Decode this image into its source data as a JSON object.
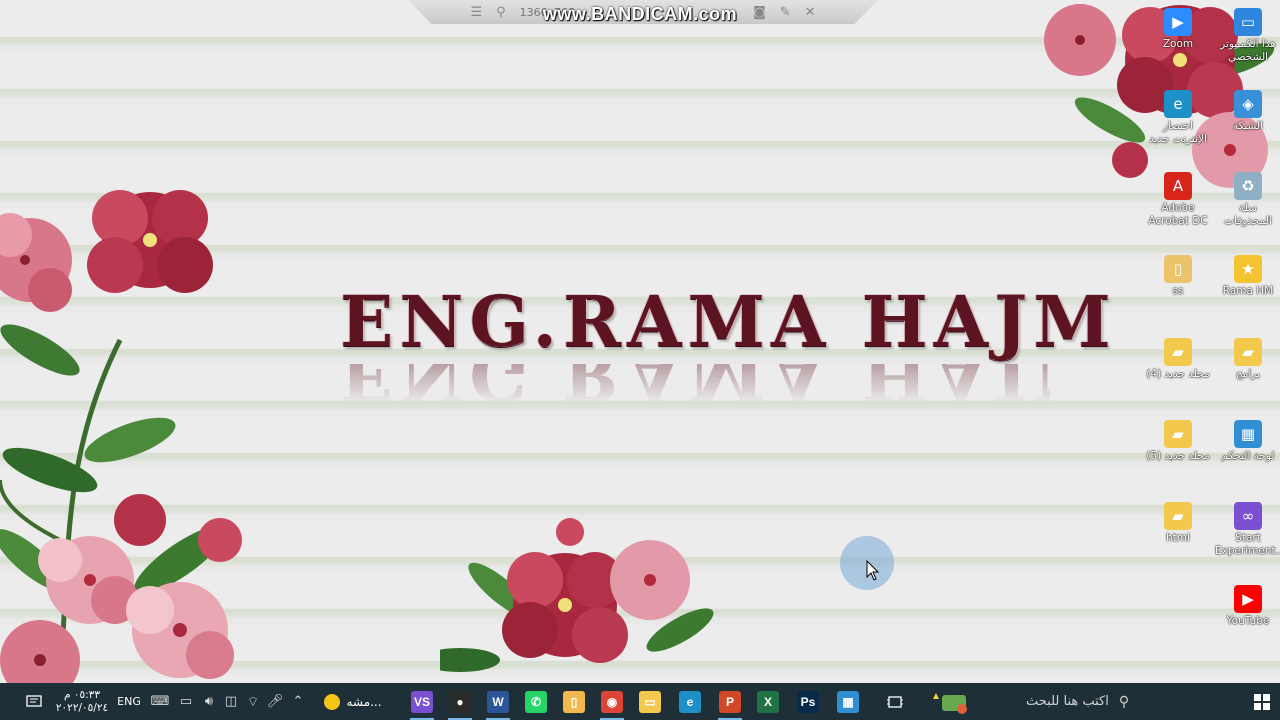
{
  "recorder": {
    "resolution_label": "1366x768",
    "watermark": "www.BANDICAM.com"
  },
  "wallpaper": {
    "title": "ENG.RAMA HAJM",
    "title_color": "#5c1420"
  },
  "desktop_icons": [
    {
      "label": "Zoom",
      "icon": "zoom-icon",
      "color": "#2d8cff"
    },
    {
      "label": "هذا الكمبيوتر الشخصي",
      "icon": "this-pc-icon",
      "color": "#2e86de"
    },
    {
      "label": "اختصار الإنترنت جديد",
      "icon": "edge-shortcut-icon",
      "color": "#1e90c8"
    },
    {
      "label": "الشبكة",
      "icon": "network-icon",
      "color": "#3a8fd9"
    },
    {
      "label": "Adobe Acrobat DC",
      "icon": "acrobat-icon",
      "color": "#d9241c"
    },
    {
      "label": "سلة المحذوفات",
      "icon": "recycle-bin-icon",
      "color": "#8fb0c4"
    },
    {
      "label": "ss",
      "icon": "file-icon",
      "color": "#e9c46a"
    },
    {
      "label": "Rama HM",
      "icon": "star-icon",
      "color": "#f4c430"
    },
    {
      "label": "مجلد جديد (4)",
      "icon": "folder-icon",
      "color": "#f2c94c"
    },
    {
      "label": "برامج",
      "icon": "folder-icon",
      "color": "#f2c94c"
    },
    {
      "label": "مجلد جديد (5)",
      "icon": "folder-icon",
      "color": "#f2c94c"
    },
    {
      "label": "لوحة التحكم",
      "icon": "control-panel-icon",
      "color": "#2f8fd2"
    },
    {
      "label": "html",
      "icon": "folder-icon",
      "color": "#f2c94c"
    },
    {
      "label": "Start Experiment...",
      "icon": "visual-studio-icon",
      "color": "#7b4fd1"
    },
    {
      "label": "YouTube",
      "icon": "youtube-icon",
      "color": "#ff0000"
    }
  ],
  "taskbar": {
    "clock_time": "٠٥:٣٣ م",
    "clock_date": "٢٠٢٢/٠٥/٢٤",
    "language": "ENG",
    "pinned_label": "مشه...",
    "search_placeholder": "اكتب هنا للبحث",
    "apps": [
      {
        "name": "visual-studio",
        "letter": "VS",
        "color": "#7b4fd1"
      },
      {
        "name": "recorder",
        "letter": "●",
        "color": "#2a2a2a"
      },
      {
        "name": "word",
        "letter": "W",
        "color": "#2b579a"
      },
      {
        "name": "whatsapp",
        "letter": "✆",
        "color": "#25d366"
      },
      {
        "name": "file-shortcut",
        "letter": "▯",
        "color": "#f2b84b"
      },
      {
        "name": "chrome",
        "letter": "◉",
        "color": "#db4437"
      },
      {
        "name": "file-explorer",
        "letter": "▭",
        "color": "#f2c94c"
      },
      {
        "name": "edge",
        "letter": "e",
        "color": "#1e90c8"
      },
      {
        "name": "powerpoint",
        "letter": "P",
        "color": "#d24726"
      },
      {
        "name": "excel",
        "letter": "X",
        "color": "#217346"
      },
      {
        "name": "photoshop",
        "letter": "Ps",
        "color": "#0a2a4a"
      },
      {
        "name": "control-panel",
        "letter": "▦",
        "color": "#2f8fd2"
      }
    ]
  }
}
